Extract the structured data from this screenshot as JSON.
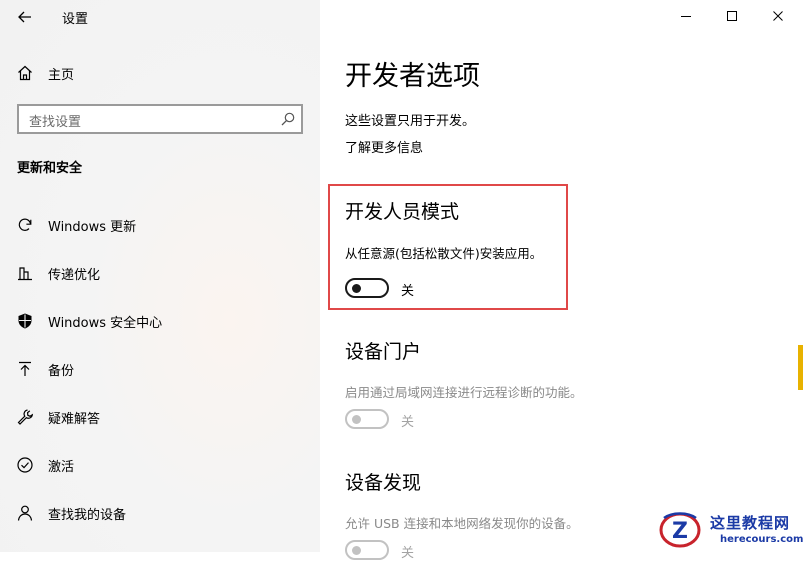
{
  "app": {
    "title": "设置"
  },
  "window": {
    "minimize": "minimize-icon",
    "maximize": "maximize-icon",
    "close": "close-icon"
  },
  "sidebar": {
    "home_label": "主页",
    "search_placeholder": "查找设置",
    "section_title": "更新和安全",
    "items": [
      {
        "label": "Windows 更新",
        "icon": "refresh-icon"
      },
      {
        "label": "传递优化",
        "icon": "delivery-optimization-icon"
      },
      {
        "label": "Windows 安全中心",
        "icon": "shield-icon"
      },
      {
        "label": "备份",
        "icon": "backup-arrow-icon"
      },
      {
        "label": "疑难解答",
        "icon": "wrench-icon"
      },
      {
        "label": "激活",
        "icon": "check-circle-icon"
      },
      {
        "label": "查找我的设备",
        "icon": "person-icon"
      }
    ]
  },
  "main": {
    "title": "开发者选项",
    "description": "这些设置只用于开发。",
    "learn_more": "了解更多信息",
    "developer_mode": {
      "title": "开发人员模式",
      "description": "从任意源(包括松散文件)安装应用。",
      "toggle_state": "关",
      "enabled": false
    },
    "device_portal": {
      "title": "设备门户",
      "description": "启用通过局域网连接进行远程诊断的功能。",
      "toggle_state": "关",
      "enabled": false
    },
    "device_discovery": {
      "title": "设备发现",
      "description": "允许 USB 连接和本地网络发现你的设备。",
      "toggle_state": "关",
      "enabled": false
    }
  },
  "watermark": {
    "title": "这里教程网",
    "url": "herecours.com",
    "logo_letter": "Z"
  },
  "colors": {
    "highlight": "#e04848",
    "watermark_blue": "#1b3aa6",
    "watermark_red": "#c8232c",
    "scroll_accent": "#e8b200"
  }
}
